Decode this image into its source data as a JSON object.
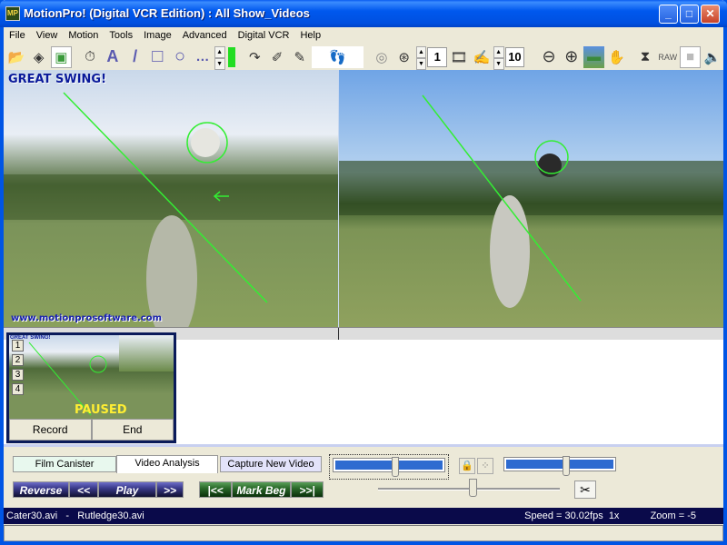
{
  "window": {
    "title": "MotionPro! (Digital VCR Edition) : All Show_Videos",
    "app_icon": "motionpro-app-icon",
    "controls": {
      "minimize": "_",
      "maximize": "□",
      "close": "✕"
    }
  },
  "menu": [
    "File",
    "View",
    "Motion",
    "Tools",
    "Image",
    "Advanced",
    "Digital VCR",
    "Help"
  ],
  "toolbar": {
    "tools": [
      {
        "icon": "open-folder-icon",
        "glyph": "📂"
      },
      {
        "icon": "film-reel-icon",
        "glyph": "◈"
      },
      {
        "icon": "dual-view-icon",
        "glyph": "▣"
      },
      {
        "icon": "stopwatch-icon",
        "glyph": "⏱"
      },
      {
        "icon": "text-tool-icon",
        "glyph": "A"
      },
      {
        "icon": "line-tool-icon",
        "glyph": "/"
      },
      {
        "icon": "rectangle-tool-icon",
        "glyph": "□"
      },
      {
        "icon": "circle-tool-icon",
        "glyph": "○"
      },
      {
        "icon": "more-tools-icon",
        "glyph": "…"
      }
    ],
    "tools2": [
      {
        "icon": "redo-icon",
        "glyph": "↷"
      },
      {
        "icon": "eraser-icon",
        "glyph": "✐"
      },
      {
        "icon": "erase-all-icon",
        "glyph": "✎"
      }
    ],
    "footprint_glyph": "👣",
    "frame_step_value": "1",
    "frame_skip_value": "10",
    "spin_up": "▲",
    "spin_down": "▼",
    "spiral_glyph": "◎",
    "reel_glyph": "⊛",
    "filmstrip_glyph": "🎞",
    "draw_glyph": "✍",
    "zoom_out_glyph": "⊖",
    "zoom_in_glyph": "⊕",
    "background_glyph": "▬",
    "hand_glyph": "✋",
    "mirror_glyph": "⧗",
    "raw_label": "RAW",
    "blank_glyph": "■",
    "audio_glyph": "🔈"
  },
  "videos": {
    "left": {
      "caption": "GREAT SWING!",
      "url_watermark": "www.motionprosoftware.com",
      "file": "Cater30.avi"
    },
    "right": {
      "file": "Rutledge30.avi"
    }
  },
  "thumbnail": {
    "caption": "GREAT SWING!",
    "camera_buttons": [
      "1",
      "2",
      "3",
      "4"
    ],
    "status": "PAUSED",
    "record_label": "Record",
    "end_label": "End"
  },
  "tabs": [
    "Film Canister",
    "Video Analysis",
    "Capture New Video"
  ],
  "active_tab": "Video Analysis",
  "vcr": {
    "reverse": "Reverse",
    "rewind": "<<",
    "play": "Play",
    "forward": ">>",
    "go_start": "|<<",
    "mark_beg": "Mark Beg",
    "go_end": ">>|"
  },
  "sliders": {
    "left_position": 0.55,
    "right_position": 0.55,
    "sync_position": 0.52,
    "lock_glyph": "🔒",
    "link_glyph": "⁘",
    "scissors_glyph": "✂"
  },
  "status": {
    "files": "Cater30.avi   -   Rutledge30.avi",
    "speed": "Speed = 30.02fps  1x",
    "zoom": "Zoom = -5"
  }
}
